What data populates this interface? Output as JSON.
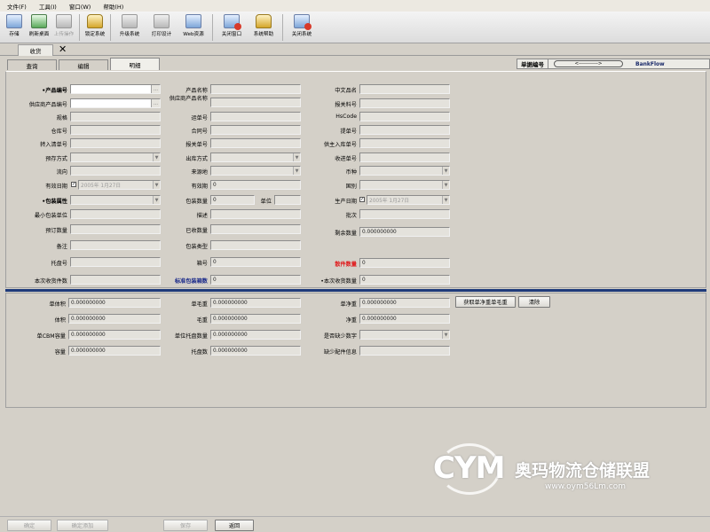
{
  "menu": [
    "文件(F)",
    "工具(I)",
    "窗口(W)",
    "帮助(H)"
  ],
  "toolbar": {
    "save": "存储",
    "refresh": "刷新桌面",
    "upload": "上传操作",
    "lock": "锁定系统",
    "upgrade": "升级系统",
    "print": "打印设计",
    "web": "Web资源",
    "close_win": "关闭窗口",
    "help": "系统帮助",
    "exit": "关闭系统"
  },
  "doc_tab": {
    "label": "收货"
  },
  "inner_tabs": [
    "查询",
    "编辑",
    "明细"
  ],
  "doc_no": {
    "label": "单据编号",
    "value": "<----------->",
    "flow": "BankFlow"
  },
  "form": {
    "product_code": "•产品编号",
    "supplier_product_code": "供应商产品编号",
    "model": "规格",
    "warehouse_no": "仓库号",
    "transfer_in_no": "转入清单号",
    "storage_method": "预存方式",
    "batch_flow": "流向",
    "expiry_date": "有效日期",
    "expiry_date_value": "2005年 1月27日",
    "package_attr": "•包装属性",
    "min_pack_unit": "最小包装单位",
    "order_qty": "预订数量",
    "remark": "备注",
    "pallet_no": "托盘号",
    "this_receive_count": "本次收货件数",
    "product_name": "产品名称",
    "supplier_product_name": "供应商产品名称",
    "shipment_no": "运单号",
    "contract_no": "合同号",
    "customs_no": "报关单号",
    "outbound_method": "出库方式",
    "origin": "来源地",
    "validity": "有效期",
    "validity_value": "0",
    "pack_qty": "包装数量",
    "pack_qty_value": "0",
    "unit": "单位",
    "description": "描述",
    "received_qty": "已收数量",
    "pack_type": "包装类型",
    "pallet_code": "箱号",
    "pallet_code_value": "0",
    "std_pack_qty": "标准包装箱数",
    "std_pack_qty_value": "0",
    "cn_name": "中文品名",
    "hs_code": "报关料号",
    "hs": "HsCode",
    "bl_no": "提单号",
    "supplier_in_no": "供主入库单号",
    "receipt_no": "收进单号",
    "currency": "币种",
    "country": "国别",
    "production_date": "生产日期",
    "production_date_value": "2005年 1月27日",
    "lot": "批次",
    "remaining_qty": "剩余数量",
    "remaining_qty_value": "0.000000000",
    "piece_qty": "散件数量",
    "piece_qty_value": "0",
    "this_receive_qty": "•本次收货数量",
    "this_receive_qty_value": "0"
  },
  "detail": {
    "unit_volume": "单体积",
    "volume": "体积",
    "unit_cbm": "单CBM容量",
    "cbm": "容量",
    "unit_weight": "单毛重",
    "gross_weight": "毛重",
    "unit_pallet_qty": "单位托盘数量",
    "pallet_qty": "托盘数",
    "unit_net_weight": "单净重",
    "net_weight": "净重",
    "missing_check": "是否缺少数字",
    "missing_info": "缺少配件信息",
    "zero": "0.000000000",
    "btn_get_weight": "获取单净重单毛重",
    "btn_clear": "清除"
  },
  "bottom": {
    "confirm": "确定",
    "confirm_add": "确定添加",
    "save": "保存",
    "back": "返回"
  },
  "watermark": {
    "logo": "CYM",
    "text": "奥玛物流仓储联盟",
    "url": "www.oym56Lm.com"
  }
}
